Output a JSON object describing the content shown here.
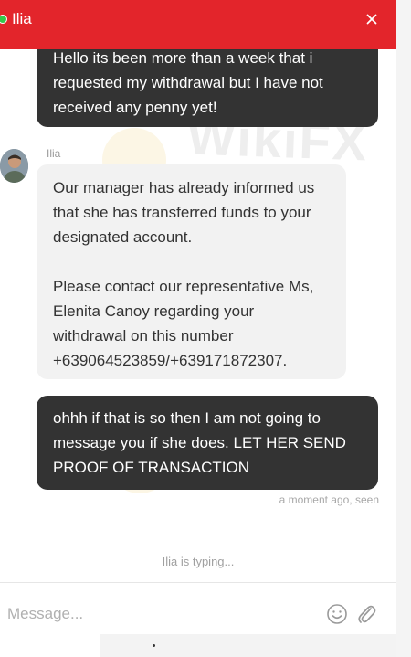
{
  "header": {
    "title": "Ilia",
    "close_icon": "close-icon"
  },
  "messages": [
    {
      "role": "user",
      "text": "Hello its been more than a week that i requested my withdrawal but I have not received any penny yet!"
    },
    {
      "role": "agent",
      "sender": "Ilia",
      "paragraphs": [
        "Our manager has already informed us that she has transferred funds to your designated account.",
        "Please contact our representative Ms, Elenita Canoy regarding your withdrawal on this number +639064523859/+639171872307."
      ]
    },
    {
      "role": "user",
      "text": "ohhh if that is so then I am not going to message you if she does. LET HER SEND PROOF OF TRANSACTION",
      "status": "a moment ago, seen"
    }
  ],
  "typing_indicator": "Ilia is typing...",
  "composer": {
    "placeholder": "Message...",
    "emoji_icon": "smiley-icon",
    "attach_icon": "paperclip-icon"
  },
  "watermark": {
    "text": "WikiFX",
    "text_2": "FX"
  },
  "colors": {
    "header_bg": "#e3252b",
    "user_bubble": "#333333",
    "agent_bubble": "#f2f2f2",
    "online": "#35c84a"
  }
}
